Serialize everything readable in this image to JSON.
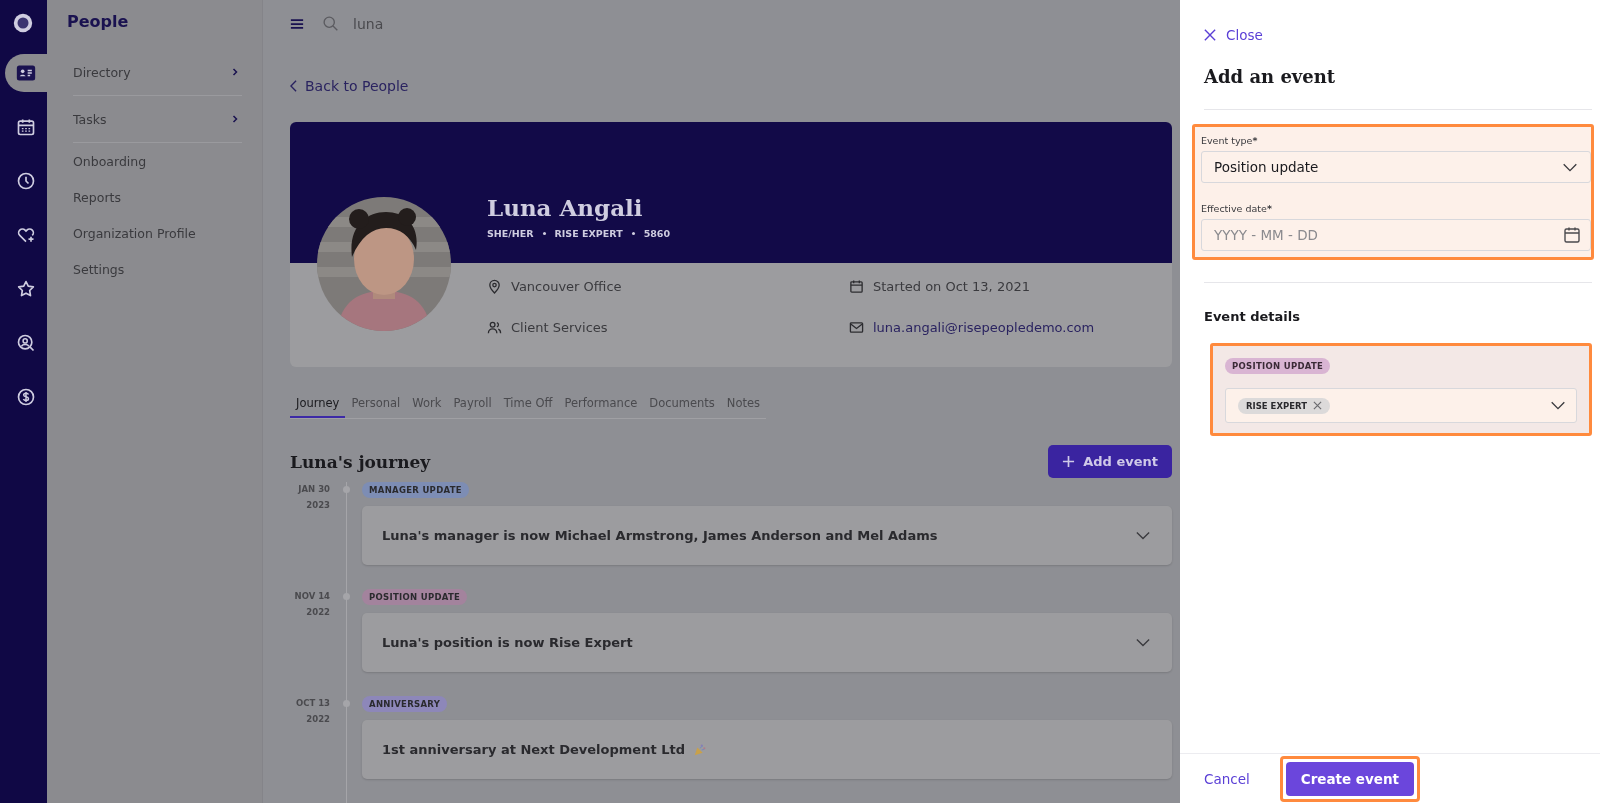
{
  "rail_items": [
    {
      "selected": true
    },
    {
      "selected": false
    },
    {
      "selected": false
    },
    {
      "selected": false
    },
    {
      "selected": false
    },
    {
      "selected": false
    },
    {
      "selected": false
    }
  ],
  "nav": {
    "title": "People",
    "items": [
      {
        "label": "Directory",
        "has_submenu": true
      },
      {
        "label": "Tasks",
        "has_submenu": true
      },
      {
        "label": "Onboarding",
        "has_submenu": false
      },
      {
        "label": "Reports",
        "has_submenu": false
      },
      {
        "label": "Organization Profile",
        "has_submenu": false
      },
      {
        "label": "Settings",
        "has_submenu": false
      }
    ]
  },
  "search": {
    "value": "luna"
  },
  "back_link": "Back to People",
  "profile": {
    "name": "Luna Angali",
    "pronouns": "SHE/HER",
    "position": "RISE EXPERT",
    "employee_id": "5860",
    "location": "Vancouver Office",
    "department": "Client Services",
    "start": "Started on Oct 13, 2021",
    "email": "luna.angali@risepeopledemo.com"
  },
  "tabs": [
    {
      "label": "Journey",
      "selected": true
    },
    {
      "label": "Personal",
      "selected": false
    },
    {
      "label": "Work",
      "selected": false
    },
    {
      "label": "Payroll",
      "selected": false
    },
    {
      "label": "Time Off",
      "selected": false
    },
    {
      "label": "Performance",
      "selected": false
    },
    {
      "label": "Documents",
      "selected": false
    },
    {
      "label": "Notes",
      "selected": false
    }
  ],
  "journey": {
    "title": "Luna's journey",
    "add_button": "Add event",
    "events": [
      {
        "date": "JAN 30",
        "year": "2023",
        "tag": "MANAGER UPDATE",
        "color": "#7d8db4",
        "text": "Luna's manager is now Michael Armstrong, James Anderson and Mel Adams",
        "expandable": true,
        "celebration": false
      },
      {
        "date": "NOV 14",
        "year": "2022",
        "tag": "POSITION UPDATE",
        "color": "#a3839d",
        "text": "Luna's position is now Rise Expert",
        "expandable": true,
        "celebration": false
      },
      {
        "date": "OCT 13",
        "year": "2022",
        "tag": "ANNIVERSARY",
        "color": "#8d87b9",
        "text": "1st anniversary at Next Development Ltd",
        "expandable": false,
        "celebration": true
      }
    ]
  },
  "drawer": {
    "close": "Close",
    "title": "Add an event",
    "form_group": {
      "highlighted": true,
      "event_type": {
        "label": "Event type",
        "required_mark": "*",
        "value": "Position update"
      },
      "effective_date": {
        "label": "Effective date",
        "required_mark": "*",
        "placeholder": "YYYY - MM - DD"
      }
    },
    "details_title": "Event details",
    "details_group": {
      "highlighted": true,
      "tag": "POSITION UPDATE",
      "color": "#d9b5d3",
      "chips": [
        {
          "label": "RISE EXPERT"
        }
      ]
    },
    "cancel": "Cancel",
    "create": {
      "label": "Create event",
      "highlighted": true
    }
  }
}
